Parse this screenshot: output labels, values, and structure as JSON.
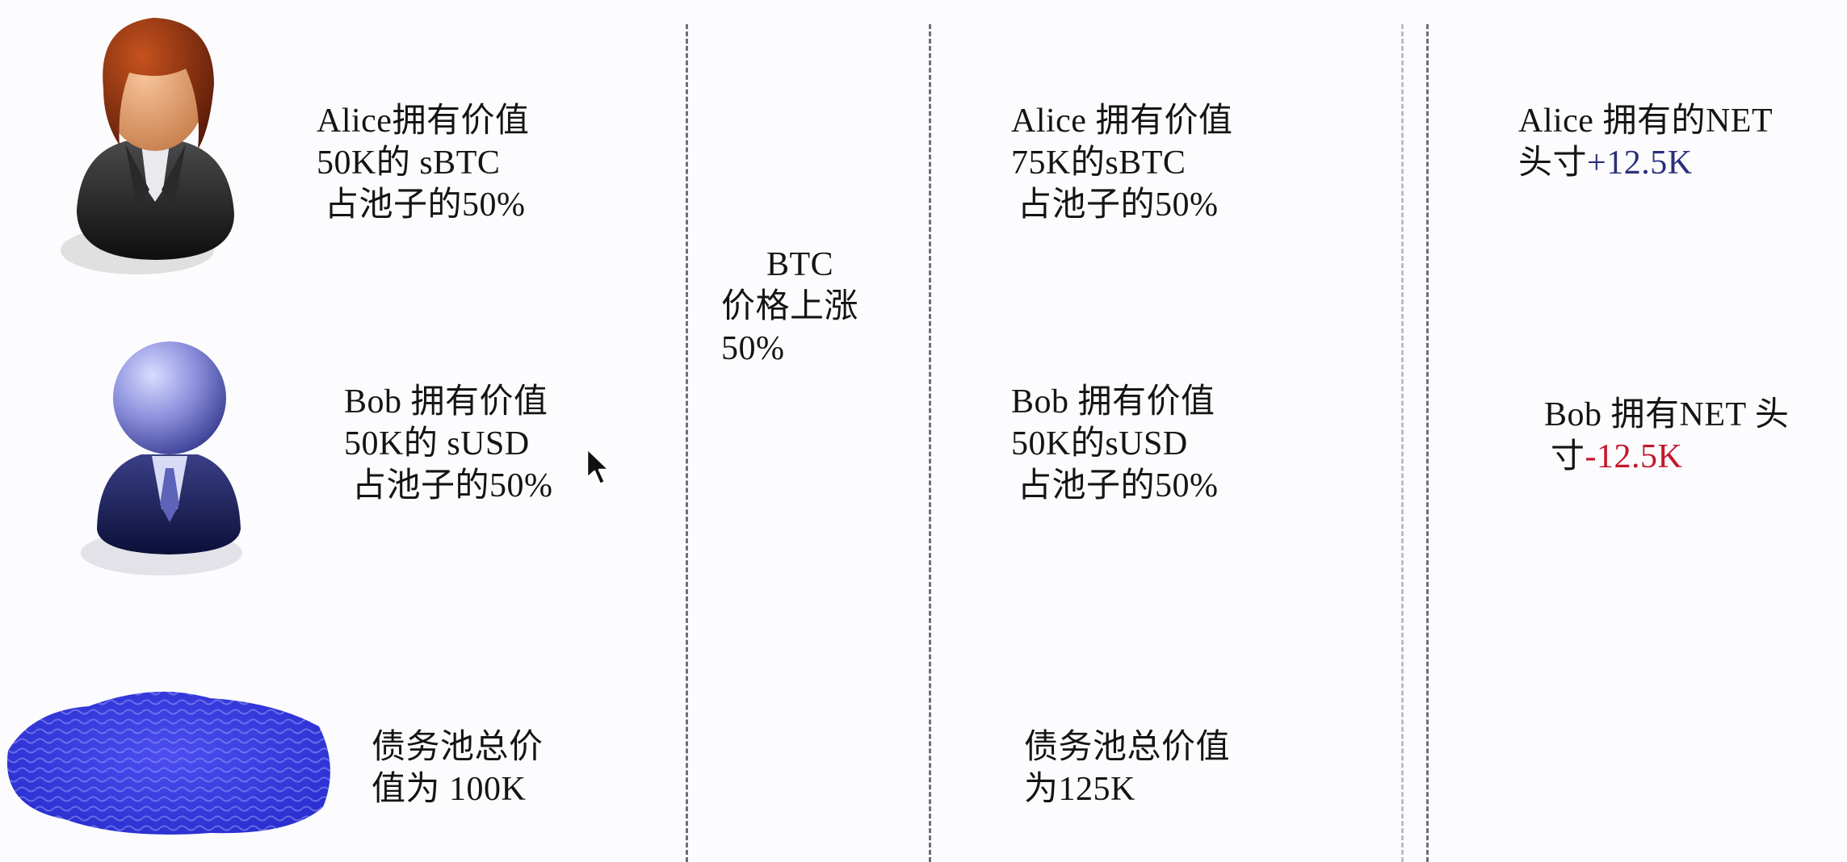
{
  "colors": {
    "positive": "#2b2f7a",
    "negative": "#c4162a",
    "divider": "#6e6e78"
  },
  "icons": {
    "alice": "woman-avatar-icon",
    "bob": "man-avatar-icon",
    "pool": "water-pool-icon",
    "cursor": "mouse-pointer-icon"
  },
  "before": {
    "alice": [
      "Alice拥有价值",
      "50K的 sBTC",
      "占池子的50%"
    ],
    "bob": [
      "Bob 拥有价值",
      "50K的 sUSD",
      "占池子的50%"
    ],
    "pool": [
      "债务池总价",
      "值为 100K"
    ]
  },
  "event": [
    "BTC",
    "价格上涨",
    "50%"
  ],
  "after": {
    "alice": [
      "Alice 拥有价值",
      "75K的sBTC",
      "占池子的50%"
    ],
    "bob": [
      "Bob 拥有价值",
      "50K的sUSD",
      "占池子的50%"
    ],
    "pool": [
      "债务池总价值",
      "为125K"
    ]
  },
  "net": {
    "alice": {
      "line1": "Alice 拥有的NET",
      "line2_prefix": "头寸",
      "line2_value": "+12.5K"
    },
    "bob": {
      "line1": "Bob 拥有NET 头",
      "line2_prefix": "寸",
      "line2_value": "-12.5K"
    }
  }
}
